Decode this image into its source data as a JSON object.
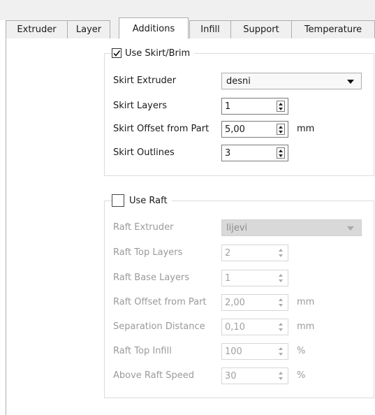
{
  "tabs": [
    {
      "label": "Extruder",
      "active": false
    },
    {
      "label": "Layer",
      "active": false
    },
    {
      "label": "Additions",
      "active": true
    },
    {
      "label": "Infill",
      "active": false
    },
    {
      "label": "Support",
      "active": false
    },
    {
      "label": "Temperature",
      "active": false
    }
  ],
  "skirt": {
    "enabled": true,
    "title": "Use Skirt/Brim",
    "extruder_label": "Skirt Extruder",
    "extruder_value": "desni",
    "layers_label": "Skirt Layers",
    "layers_value": "1",
    "offset_label": "Skirt Offset from Part",
    "offset_value": "5,00",
    "offset_unit": "mm",
    "outlines_label": "Skirt Outlines",
    "outlines_value": "3"
  },
  "raft": {
    "enabled": false,
    "title": "Use Raft",
    "extruder_label": "Raft Extruder",
    "extruder_value": "lijevi",
    "top_layers_label": "Raft Top Layers",
    "top_layers_value": "2",
    "base_layers_label": "Raft Base Layers",
    "base_layers_value": "1",
    "offset_label": "Raft Offset from Part",
    "offset_value": "2,00",
    "offset_unit": "mm",
    "separation_label": "Separation Distance",
    "separation_value": "0,10",
    "separation_unit": "mm",
    "top_infill_label": "Raft Top Infill",
    "top_infill_value": "100",
    "top_infill_unit": "%",
    "speed_label": "Above Raft Speed",
    "speed_value": "30",
    "speed_unit": "%"
  }
}
